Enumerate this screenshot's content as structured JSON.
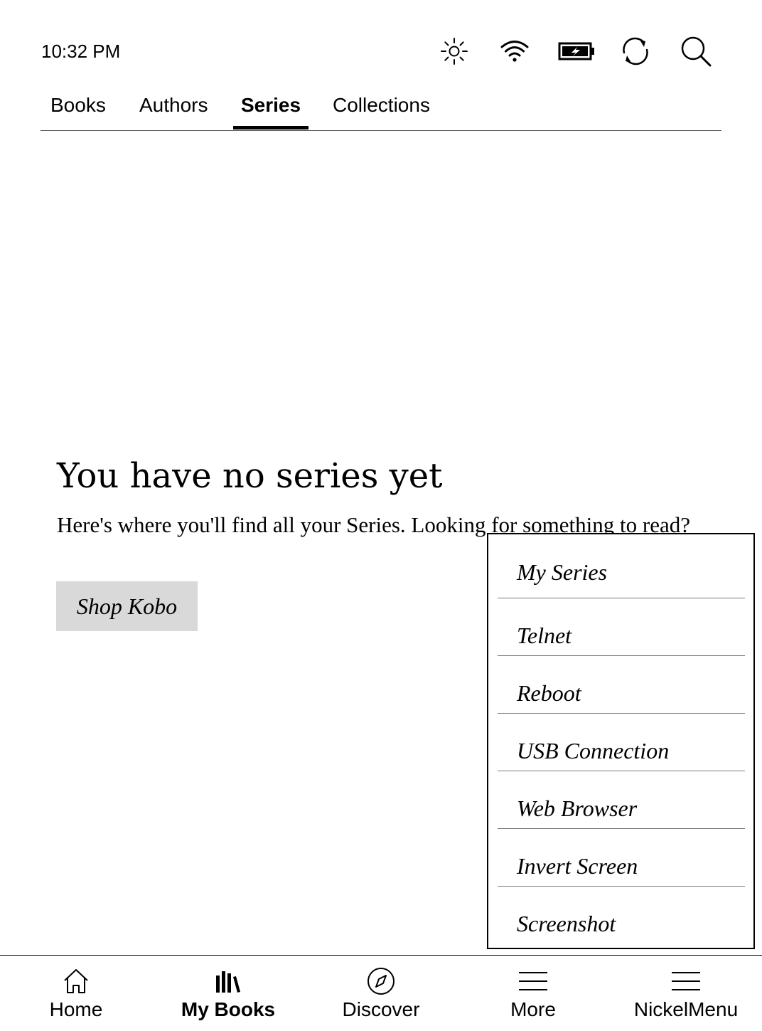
{
  "status_bar": {
    "time": "10:32 PM",
    "icons": [
      "brightness-icon",
      "wifi-icon",
      "battery-charging-icon",
      "sync-icon",
      "search-icon"
    ]
  },
  "tabs": [
    {
      "label": "Books",
      "active": false
    },
    {
      "label": "Authors",
      "active": false
    },
    {
      "label": "Series",
      "active": true
    },
    {
      "label": "Collections",
      "active": false
    }
  ],
  "empty_state": {
    "title": "You have no series yet",
    "description": "Here's where you'll find all your Series. Looking for something to read?",
    "button_label": "Shop Kobo"
  },
  "popup_menu": {
    "items": [
      "My Series",
      "Telnet",
      "Reboot",
      "USB Connection",
      "Web Browser",
      "Invert Screen",
      "Screenshot"
    ]
  },
  "bottom_nav": {
    "items": [
      {
        "label": "Home",
        "icon": "home-icon",
        "active": false
      },
      {
        "label": "My Books",
        "icon": "library-icon",
        "active": true
      },
      {
        "label": "Discover",
        "icon": "compass-icon",
        "active": false
      },
      {
        "label": "More",
        "icon": "menu-icon",
        "active": false
      },
      {
        "label": "NickelMenu",
        "icon": "menu-icon",
        "active": false
      }
    ]
  }
}
